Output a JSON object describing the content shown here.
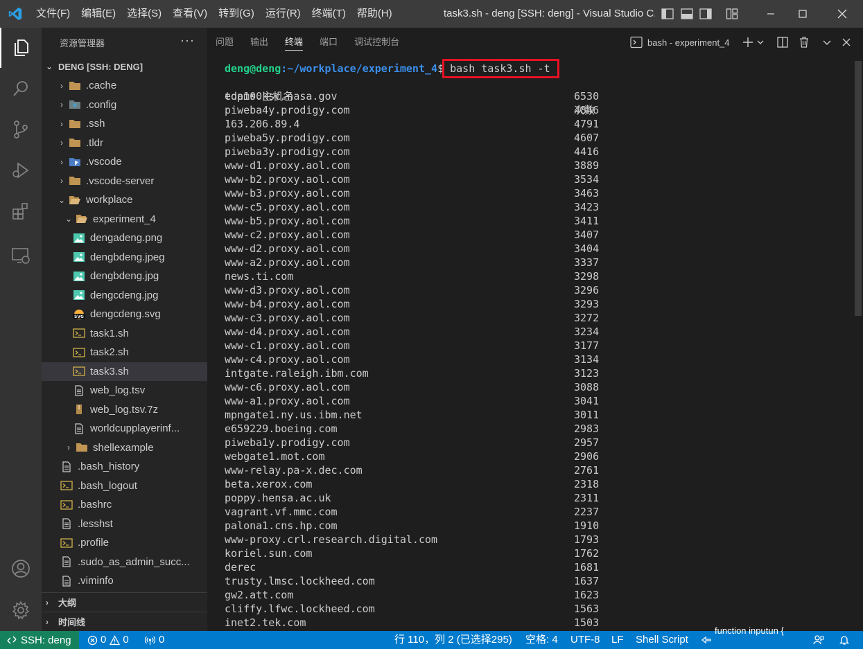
{
  "titlebar": {
    "menu": [
      "文件(F)",
      "编辑(E)",
      "选择(S)",
      "查看(V)",
      "转到(G)",
      "运行(R)",
      "终端(T)",
      "帮助(H)"
    ],
    "window_title": "task3.sh - deng [SSH: deng] - Visual Studio C..."
  },
  "sidebar": {
    "title": "资源管理器",
    "more": "···",
    "root": "DENG [SSH: DENG]",
    "items": [
      {
        "label": ".cache",
        "kind": "folder",
        "indent": 1,
        "chev": "›"
      },
      {
        "label": ".config",
        "kind": "folder-config",
        "indent": 1,
        "chev": "›"
      },
      {
        "label": ".ssh",
        "kind": "folder",
        "indent": 1,
        "chev": "›"
      },
      {
        "label": ".tldr",
        "kind": "folder",
        "indent": 1,
        "chev": "›"
      },
      {
        "label": ".vscode",
        "kind": "folder-vscode",
        "indent": 1,
        "chev": "›"
      },
      {
        "label": ".vscode-server",
        "kind": "folder",
        "indent": 1,
        "chev": "›"
      },
      {
        "label": "workplace",
        "kind": "folder-open",
        "indent": 1,
        "chev": "⌄"
      },
      {
        "label": "experiment_4",
        "kind": "folder-open",
        "indent": 2,
        "chev": "⌄"
      },
      {
        "label": "dengadeng.png",
        "kind": "image",
        "indent": 3,
        "chev": ""
      },
      {
        "label": "dengbdeng.jpeg",
        "kind": "image",
        "indent": 3,
        "chev": ""
      },
      {
        "label": "dengbdeng.jpg",
        "kind": "image",
        "indent": 3,
        "chev": ""
      },
      {
        "label": "dengcdeng.jpg",
        "kind": "image",
        "indent": 3,
        "chev": ""
      },
      {
        "label": "dengcdeng.svg",
        "kind": "svg",
        "indent": 3,
        "chev": ""
      },
      {
        "label": "task1.sh",
        "kind": "shell",
        "indent": 3,
        "chev": ""
      },
      {
        "label": "task2.sh",
        "kind": "shell",
        "indent": 3,
        "chev": ""
      },
      {
        "label": "task3.sh",
        "kind": "shell",
        "indent": 3,
        "chev": "",
        "selected": true
      },
      {
        "label": "web_log.tsv",
        "kind": "file",
        "indent": 3,
        "chev": ""
      },
      {
        "label": "web_log.tsv.7z",
        "kind": "archive",
        "indent": 3,
        "chev": ""
      },
      {
        "label": "worldcupplayerinf...",
        "kind": "file",
        "indent": 3,
        "chev": ""
      },
      {
        "label": "shellexample",
        "kind": "folder",
        "indent": 2,
        "chev": "›"
      },
      {
        "label": ".bash_history",
        "kind": "file",
        "indent": 1,
        "chev": ""
      },
      {
        "label": ".bash_logout",
        "kind": "shell",
        "indent": 1,
        "chev": ""
      },
      {
        "label": ".bashrc",
        "kind": "shell",
        "indent": 1,
        "chev": ""
      },
      {
        "label": ".lesshst",
        "kind": "file",
        "indent": 1,
        "chev": ""
      },
      {
        "label": ".profile",
        "kind": "shell",
        "indent": 1,
        "chev": ""
      },
      {
        "label": ".sudo_as_admin_succ...",
        "kind": "file",
        "indent": 1,
        "chev": ""
      },
      {
        "label": ".viminfo",
        "kind": "file",
        "indent": 1,
        "chev": ""
      }
    ],
    "sections": [
      "大纲",
      "时间线"
    ]
  },
  "panel": {
    "tabs": [
      "问题",
      "输出",
      "终端",
      "端口",
      "调试控制台"
    ],
    "active_tab": "终端",
    "terminal_name": "bash - experiment_4"
  },
  "terminal": {
    "prompt_user": "deng@deng",
    "prompt_path": ":~/workplace/experiment_4",
    "prompt_symbol": "$",
    "command": "bash task3.sh -t",
    "header_host": "top100主机名",
    "header_count": "次数",
    "rows": [
      [
        "edams.ksc.nasa.gov",
        "6530"
      ],
      [
        "piweba4y.prodigy.com",
        "4846"
      ],
      [
        "163.206.89.4",
        "4791"
      ],
      [
        "piweba5y.prodigy.com",
        "4607"
      ],
      [
        "piweba3y.prodigy.com",
        "4416"
      ],
      [
        "www-d1.proxy.aol.com",
        "3889"
      ],
      [
        "www-b2.proxy.aol.com",
        "3534"
      ],
      [
        "www-b3.proxy.aol.com",
        "3463"
      ],
      [
        "www-c5.proxy.aol.com",
        "3423"
      ],
      [
        "www-b5.proxy.aol.com",
        "3411"
      ],
      [
        "www-c2.proxy.aol.com",
        "3407"
      ],
      [
        "www-d2.proxy.aol.com",
        "3404"
      ],
      [
        "www-a2.proxy.aol.com",
        "3337"
      ],
      [
        "news.ti.com",
        "3298"
      ],
      [
        "www-d3.proxy.aol.com",
        "3296"
      ],
      [
        "www-b4.proxy.aol.com",
        "3293"
      ],
      [
        "www-c3.proxy.aol.com",
        "3272"
      ],
      [
        "www-d4.proxy.aol.com",
        "3234"
      ],
      [
        "www-c1.proxy.aol.com",
        "3177"
      ],
      [
        "www-c4.proxy.aol.com",
        "3134"
      ],
      [
        "intgate.raleigh.ibm.com",
        "3123"
      ],
      [
        "www-c6.proxy.aol.com",
        "3088"
      ],
      [
        "www-a1.proxy.aol.com",
        "3041"
      ],
      [
        "mpngate1.ny.us.ibm.net",
        "3011"
      ],
      [
        "e659229.boeing.com",
        "2983"
      ],
      [
        "piweba1y.prodigy.com",
        "2957"
      ],
      [
        "webgate1.mot.com",
        "2906"
      ],
      [
        "www-relay.pa-x.dec.com",
        "2761"
      ],
      [
        "beta.xerox.com",
        "2318"
      ],
      [
        "poppy.hensa.ac.uk",
        "2311"
      ],
      [
        "vagrant.vf.mmc.com",
        "2237"
      ],
      [
        "palona1.cns.hp.com",
        "1910"
      ],
      [
        "www-proxy.crl.research.digital.com",
        "1793"
      ],
      [
        "koriel.sun.com",
        "1762"
      ],
      [
        "derec",
        "1681"
      ],
      [
        "trusty.lmsc.lockheed.com",
        "1637"
      ],
      [
        "gw2.att.com",
        "1623"
      ],
      [
        "cliffy.lfwc.lockheed.com",
        "1563"
      ],
      [
        "inet2.tek.com",
        "1503"
      ]
    ]
  },
  "statusbar": {
    "remote": "SSH: deng",
    "errors": "0",
    "warnings": "0",
    "ports": "0",
    "position": "行 110，列 2 (已选择295)",
    "spaces": "空格: 4",
    "encoding": "UTF-8",
    "eol": "LF",
    "language": "Shell Script",
    "func_hint": "function inputun {"
  },
  "colors": {
    "accent": "#007acc",
    "remote": "#16825d",
    "prompt_user": "#23d18b",
    "prompt_path": "#3b8eea",
    "highlight_box": "#e81123"
  }
}
